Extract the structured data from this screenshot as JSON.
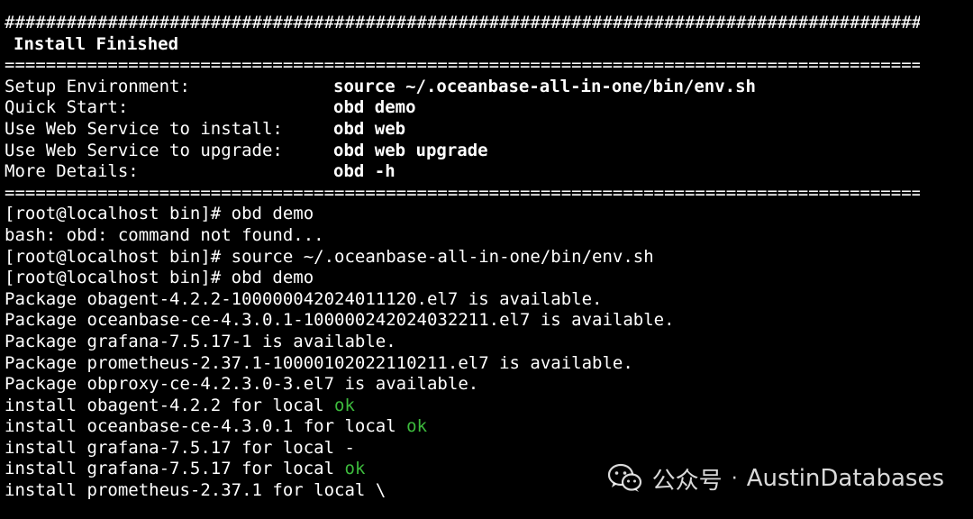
{
  "banner": {
    "hash_rule": "##########################################################################################",
    "title": "Install Finished",
    "eq_rule": "=========================================================================================="
  },
  "info_rows": [
    {
      "key": "Setup Environment:",
      "value": "source ~/.oceanbase-all-in-one/bin/env.sh"
    },
    {
      "key": "Quick Start:",
      "value": "obd demo"
    },
    {
      "key": "Use Web Service to install:",
      "value": "obd web"
    },
    {
      "key": "Use Web Service to upgrade:",
      "value": "obd web upgrade"
    },
    {
      "key": "More Details:",
      "value": "obd -h"
    }
  ],
  "output_lines": [
    "[root@localhost bin]# obd demo",
    "bash: obd: command not found...",
    "[root@localhost bin]# source ~/.oceanbase-all-in-one/bin/env.sh",
    "[root@localhost bin]# obd demo",
    "Package obagent-4.2.2-100000042024011120.el7 is available.",
    "Package oceanbase-ce-4.3.0.1-100000242024032211.el7 is available.",
    "Package grafana-7.5.17-1 is available.",
    "Package prometheus-2.37.1-10000102022110211.el7 is available.",
    "Package obproxy-ce-4.2.3.0-3.el7 is available."
  ],
  "install_lines": [
    {
      "text": "install obagent-4.2.2 for local ",
      "status": "ok",
      "status_color": "green"
    },
    {
      "text": "install oceanbase-ce-4.3.0.1 for local ",
      "status": "ok",
      "status_color": "green"
    },
    {
      "text": "install grafana-7.5.17 for local ",
      "status": "-",
      "status_color": "white"
    },
    {
      "text": "install grafana-7.5.17 for local ",
      "status": "ok",
      "status_color": "green"
    },
    {
      "text": "install prometheus-2.37.1 for local ",
      "status": "\\",
      "status_color": "white"
    }
  ],
  "watermark": {
    "icon": "wechat-icon",
    "platform": "公众号",
    "separator": "·",
    "account": "AustinDatabases"
  },
  "colors": {
    "background": "#000000",
    "text": "#ffffff",
    "ok_green": "#3dbb3d"
  }
}
